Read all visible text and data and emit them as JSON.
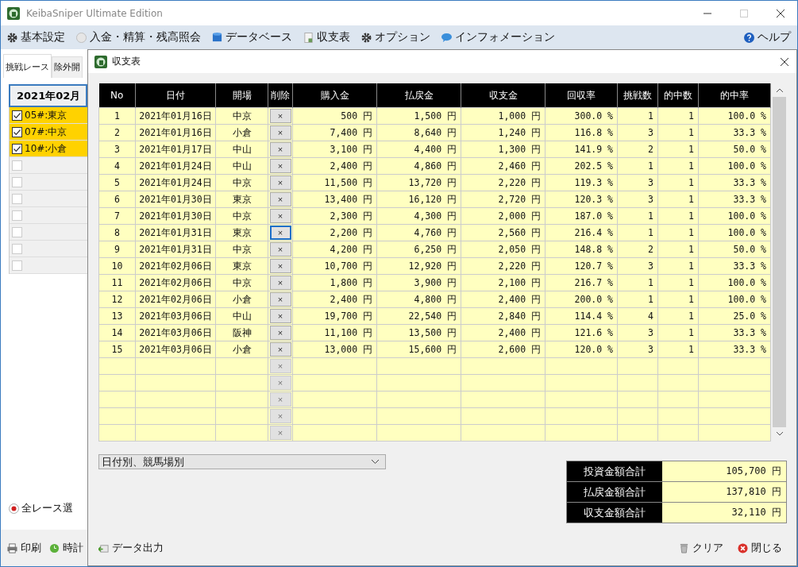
{
  "window": {
    "title": "KeibaSniper Ultimate Edition"
  },
  "menu": [
    {
      "label": "基本設定",
      "kind": "gear"
    },
    {
      "label": "入金・精算・残高照会",
      "kind": "coin"
    },
    {
      "label": "データベース",
      "kind": "database"
    },
    {
      "label": "収支表",
      "kind": "sheet"
    },
    {
      "label": "オプション",
      "kind": "gear"
    },
    {
      "label": "インフォメーション",
      "kind": "chat"
    }
  ],
  "help": {
    "label": "ヘルプ"
  },
  "left_panel": {
    "tabs": [
      {
        "label": "挑戦レース",
        "selected": true
      },
      {
        "label": "除外開",
        "selected": false
      }
    ],
    "date": "2021年02月",
    "races": [
      {
        "label": "05#:東京",
        "checked": true
      },
      {
        "label": "07#:中京",
        "checked": true
      },
      {
        "label": "10#:小倉",
        "checked": true
      },
      {
        "checked": false
      },
      {
        "checked": false
      },
      {
        "checked": false
      },
      {
        "checked": false
      },
      {
        "checked": false
      },
      {
        "checked": false
      },
      {
        "checked": false
      }
    ],
    "radio": {
      "label": "全レース選",
      "selected": true
    },
    "footer": [
      {
        "label": "印刷",
        "kind": "printer"
      },
      {
        "label": "時計",
        "kind": "clock"
      }
    ]
  },
  "dialog": {
    "title": "収支表",
    "columns": [
      "No",
      "日付",
      "開場",
      "削除",
      "購入金",
      "払戻金",
      "収支金",
      "回収率",
      "挑戦数",
      "的中数",
      "的中率"
    ],
    "rows": [
      {
        "no": "1",
        "date": "2021年01月16日",
        "venue": "中京",
        "delete": "×",
        "focused": false,
        "disabled": false,
        "purchase": "500 円",
        "payout": "1,500 円",
        "balance": "1,000 円",
        "return_rate": "300.0 %",
        "bets": "1",
        "hits": "1",
        "hit_rate": "100.0 %"
      },
      {
        "no": "2",
        "date": "2021年01月16日",
        "venue": "小倉",
        "delete": "×",
        "focused": false,
        "disabled": false,
        "purchase": "7,400 円",
        "payout": "8,640 円",
        "balance": "1,240 円",
        "return_rate": "116.8 %",
        "bets": "3",
        "hits": "1",
        "hit_rate": "33.3 %"
      },
      {
        "no": "3",
        "date": "2021年01月17日",
        "venue": "中山",
        "delete": "×",
        "focused": false,
        "disabled": false,
        "purchase": "3,100 円",
        "payout": "4,400 円",
        "balance": "1,300 円",
        "return_rate": "141.9 %",
        "bets": "2",
        "hits": "1",
        "hit_rate": "50.0 %"
      },
      {
        "no": "4",
        "date": "2021年01月24日",
        "venue": "中山",
        "delete": "×",
        "focused": false,
        "disabled": false,
        "purchase": "2,400 円",
        "payout": "4,860 円",
        "balance": "2,460 円",
        "return_rate": "202.5 %",
        "bets": "1",
        "hits": "1",
        "hit_rate": "100.0 %"
      },
      {
        "no": "5",
        "date": "2021年01月24日",
        "venue": "中京",
        "delete": "×",
        "focused": false,
        "disabled": false,
        "purchase": "11,500 円",
        "payout": "13,720 円",
        "balance": "2,220 円",
        "return_rate": "119.3 %",
        "bets": "3",
        "hits": "1",
        "hit_rate": "33.3 %"
      },
      {
        "no": "6",
        "date": "2021年01月30日",
        "venue": "東京",
        "delete": "×",
        "focused": false,
        "disabled": false,
        "purchase": "13,400 円",
        "payout": "16,120 円",
        "balance": "2,720 円",
        "return_rate": "120.3 %",
        "bets": "3",
        "hits": "1",
        "hit_rate": "33.3 %"
      },
      {
        "no": "7",
        "date": "2021年01月30日",
        "venue": "中京",
        "delete": "×",
        "focused": false,
        "disabled": false,
        "purchase": "2,300 円",
        "payout": "4,300 円",
        "balance": "2,000 円",
        "return_rate": "187.0 %",
        "bets": "1",
        "hits": "1",
        "hit_rate": "100.0 %"
      },
      {
        "no": "8",
        "date": "2021年01月31日",
        "venue": "東京",
        "delete": "×",
        "focused": true,
        "disabled": false,
        "purchase": "2,200 円",
        "payout": "4,760 円",
        "balance": "2,560 円",
        "return_rate": "216.4 %",
        "bets": "1",
        "hits": "1",
        "hit_rate": "100.0 %"
      },
      {
        "no": "9",
        "date": "2021年01月31日",
        "venue": "中京",
        "delete": "×",
        "focused": false,
        "disabled": false,
        "purchase": "4,200 円",
        "payout": "6,250 円",
        "balance": "2,050 円",
        "return_rate": "148.8 %",
        "bets": "2",
        "hits": "1",
        "hit_rate": "50.0 %"
      },
      {
        "no": "10",
        "date": "2021年02月06日",
        "venue": "東京",
        "delete": "×",
        "focused": false,
        "disabled": false,
        "purchase": "10,700 円",
        "payout": "12,920 円",
        "balance": "2,220 円",
        "return_rate": "120.7 %",
        "bets": "3",
        "hits": "1",
        "hit_rate": "33.3 %"
      },
      {
        "no": "11",
        "date": "2021年02月06日",
        "venue": "中京",
        "delete": "×",
        "focused": false,
        "disabled": false,
        "purchase": "1,800 円",
        "payout": "3,900 円",
        "balance": "2,100 円",
        "return_rate": "216.7 %",
        "bets": "1",
        "hits": "1",
        "hit_rate": "100.0 %"
      },
      {
        "no": "12",
        "date": "2021年02月06日",
        "venue": "小倉",
        "delete": "×",
        "focused": false,
        "disabled": false,
        "purchase": "2,400 円",
        "payout": "4,800 円",
        "balance": "2,400 円",
        "return_rate": "200.0 %",
        "bets": "1",
        "hits": "1",
        "hit_rate": "100.0 %"
      },
      {
        "no": "13",
        "date": "2021年03月06日",
        "venue": "中山",
        "delete": "×",
        "focused": false,
        "disabled": false,
        "purchase": "19,700 円",
        "payout": "22,540 円",
        "balance": "2,840 円",
        "return_rate": "114.4 %",
        "bets": "4",
        "hits": "1",
        "hit_rate": "25.0 %"
      },
      {
        "no": "14",
        "date": "2021年03月06日",
        "venue": "阪神",
        "delete": "×",
        "focused": false,
        "disabled": false,
        "purchase": "11,100 円",
        "payout": "13,500 円",
        "balance": "2,400 円",
        "return_rate": "121.6 %",
        "bets": "3",
        "hits": "1",
        "hit_rate": "33.3 %"
      },
      {
        "no": "15",
        "date": "2021年03月06日",
        "venue": "小倉",
        "delete": "×",
        "focused": false,
        "disabled": false,
        "purchase": "13,000 円",
        "payout": "15,600 円",
        "balance": "2,600 円",
        "return_rate": "120.0 %",
        "bets": "3",
        "hits": "1",
        "hit_rate": "33.3 %"
      },
      {
        "delete": "×",
        "focused": false,
        "disabled": true
      },
      {
        "delete": "×",
        "focused": false,
        "disabled": true
      },
      {
        "delete": "×",
        "focused": false,
        "disabled": true
      },
      {
        "delete": "×",
        "focused": false,
        "disabled": true
      },
      {
        "delete": "×",
        "focused": false,
        "disabled": true
      }
    ],
    "grouping": {
      "value": "日付別、競馬場別"
    },
    "totals": [
      {
        "label": "投資金額合計",
        "value": "105,700 円"
      },
      {
        "label": "払戻金額合計",
        "value": "137,810 円"
      },
      {
        "label": "収支金額合計",
        "value": "32,110 円"
      }
    ],
    "buttons": [
      {
        "label": "データ出力",
        "kind": "export"
      },
      {
        "label": "クリア",
        "kind": "trash"
      },
      {
        "label": "閉じる",
        "kind": "close"
      }
    ]
  }
}
